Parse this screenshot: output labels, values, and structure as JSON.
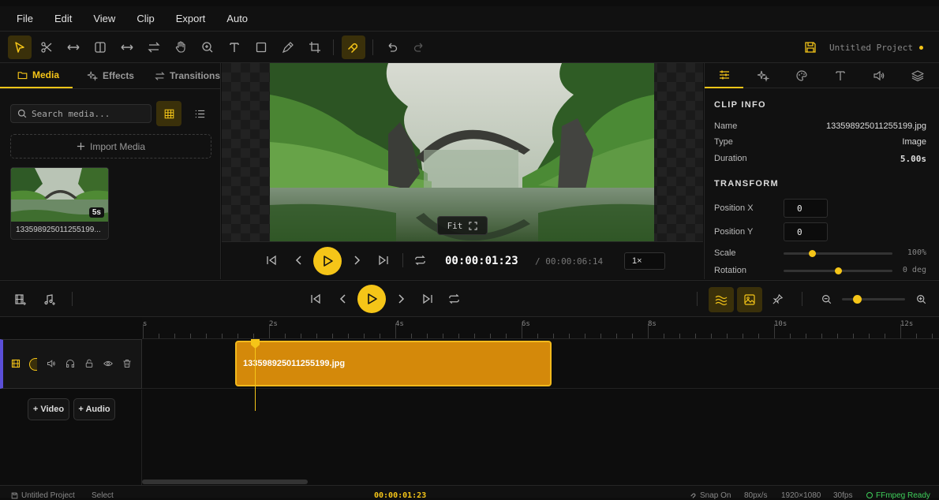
{
  "menu": [
    "File",
    "Edit",
    "View",
    "Clip",
    "Export",
    "Auto"
  ],
  "toolbar": {
    "tools": [
      {
        "name": "select-tool",
        "icon": "cursor-icon",
        "active": true
      },
      {
        "name": "cut-tool",
        "icon": "scissors-icon"
      },
      {
        "name": "trim-tool",
        "icon": "arrows-horizontal-icon"
      },
      {
        "name": "split-tool",
        "icon": "split-columns-icon"
      },
      {
        "name": "slip-tool",
        "icon": "arrows-horizontal-icon"
      },
      {
        "name": "swap-tool",
        "icon": "swap-icon"
      },
      {
        "name": "hand-tool",
        "icon": "hand-icon"
      },
      {
        "name": "zoom-tool",
        "icon": "zoom-icon"
      },
      {
        "name": "text-tool",
        "icon": "text-icon"
      },
      {
        "name": "shape-tool",
        "icon": "rectangle-icon"
      },
      {
        "name": "pen-tool",
        "icon": "pen-icon"
      },
      {
        "name": "crop-tool",
        "icon": "crop-icon"
      },
      {
        "name": "magnet-tool",
        "icon": "magnet-icon",
        "active": true
      },
      {
        "name": "undo-button",
        "icon": "undo-icon"
      },
      {
        "name": "redo-button",
        "icon": "redo-icon"
      }
    ],
    "project_name": "Untitled Project",
    "accent": "#f5c518"
  },
  "left_panel": {
    "tabs": [
      "Media",
      "Effects",
      "Transitions"
    ],
    "search_placeholder": "Search media...",
    "import_label": "Import Media",
    "media_items": [
      {
        "name": "133598925011255199...",
        "duration": "5s"
      }
    ]
  },
  "preview": {
    "fit_label": "Fit",
    "current_time": "00:00:01:23",
    "total_time": "/ 00:00:06:14",
    "speed": "1×"
  },
  "inspector": {
    "tabs": [
      "adjust-icon",
      "effects-icon",
      "color-icon",
      "text-icon",
      "audio-icon",
      "layers-icon"
    ],
    "clip_info_title": "CLIP INFO",
    "fields": [
      {
        "label": "Name",
        "value": "133598925011255199.jpg"
      },
      {
        "label": "Type",
        "value": "Image"
      },
      {
        "label": "Duration",
        "value": "5.00s"
      }
    ],
    "transform_title": "TRANSFORM",
    "position_x_label": "Position X",
    "position_x": "0",
    "position_y_label": "Position Y",
    "position_y": "0",
    "scale_label": "Scale",
    "scale_value": "100%",
    "scale_level": 0.25,
    "rotation_label": "Rotation",
    "rotation_value": "0 deg",
    "rotation_level": 0.5
  },
  "timeline": {
    "ruler_labels": [
      "s",
      "2s",
      "4s",
      "6s",
      "8s",
      "10s",
      "12s"
    ],
    "clip_name": "133598925011255199.jpg",
    "add_video": "+ Video",
    "add_audio": "+ Audio",
    "zoom_level": 0.2
  },
  "status_bar": {
    "project": "Untitled Project",
    "mode": "Select",
    "time": "00:00:01:23",
    "snap": "Snap On",
    "zoom": "80px/s",
    "resolution": "1920×1080",
    "fps": "30fps",
    "ffmpeg": "FFmpeg Ready",
    "ffmpeg_color": "#3ecf5a"
  }
}
